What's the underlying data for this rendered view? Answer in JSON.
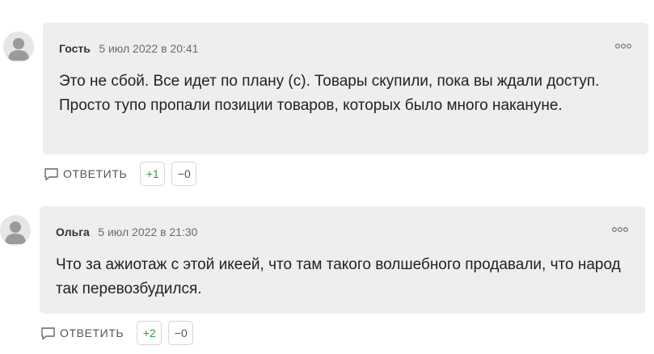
{
  "comments": [
    {
      "author": "Гость",
      "date": "5 июл 2022 в 20:41",
      "text": "Это не сбой. Все идет по плану (с). Товары скупили, пока вы ждали доступ. Просто тупо пропали позиции товаров, которых было много накануне.",
      "reply_label": "ОТВЕТИТЬ",
      "upvotes": "+1",
      "downvotes": "−0",
      "avatar_icon": "user-avatar-icon",
      "more_icon": "more-options-icon",
      "reply_icon": "speech-bubble-icon"
    },
    {
      "author": "Ольга",
      "date": "5 июл 2022 в 21:30",
      "text": "Что за ажиотаж с этой икеей, что там такого волшебного продавали, что народ так перевозбудился.",
      "reply_label": "ОТВЕТИТЬ",
      "upvotes": "+2",
      "downvotes": "−0",
      "avatar_icon": "user-avatar-icon",
      "more_icon": "more-options-icon",
      "reply_icon": "speech-bubble-icon"
    }
  ],
  "colors": {
    "bubble_bg": "#eeeeee",
    "upvote": "#2e9a4a",
    "avatar_bg": "#e6e6e6",
    "avatar_fg": "#9a9a9a"
  }
}
